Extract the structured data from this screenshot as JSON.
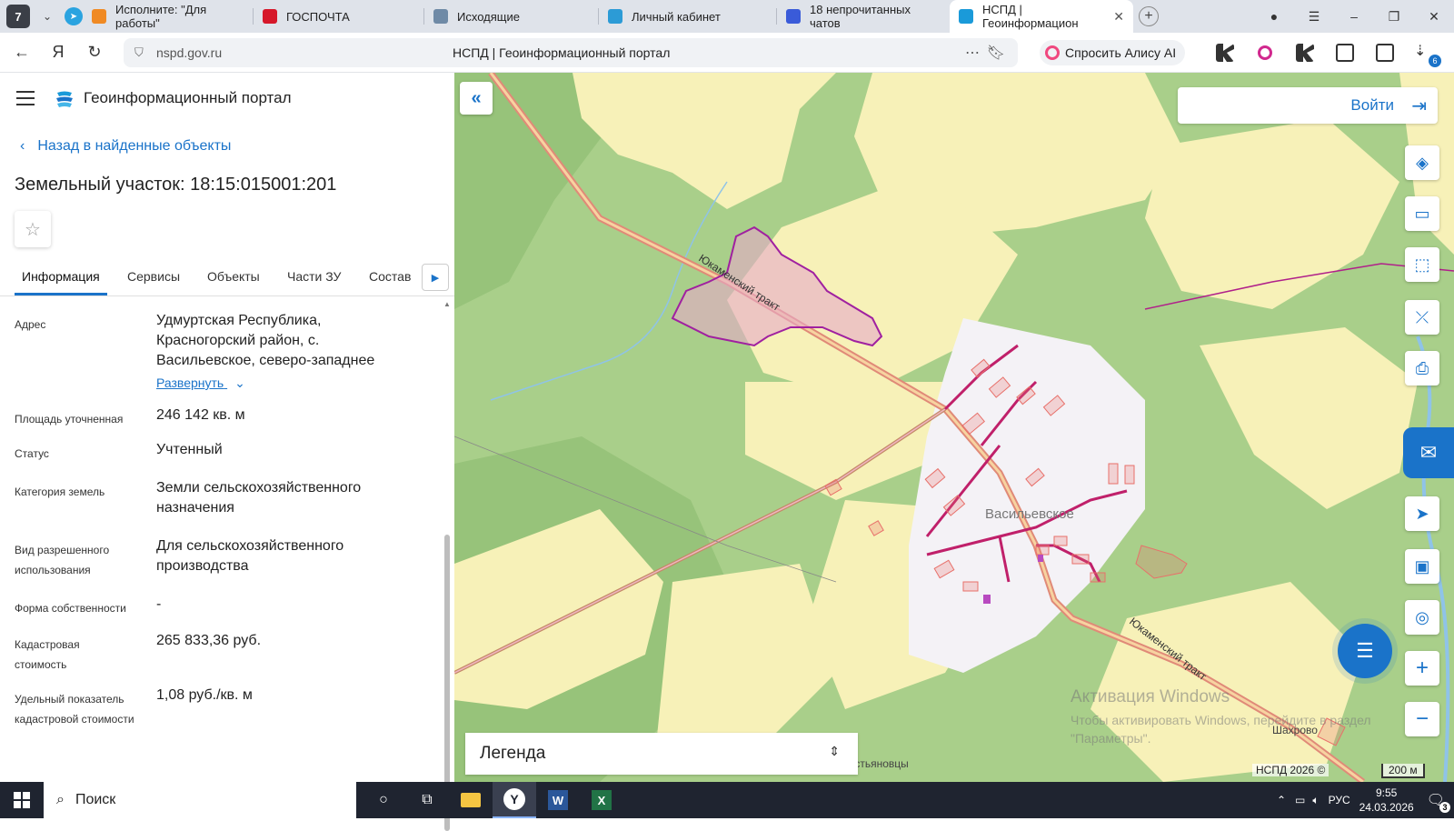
{
  "browser": {
    "tab_count": "7",
    "tabs": [
      {
        "label": "Исполните: \"Для работы\"",
        "color": "#f08a24"
      },
      {
        "label": "ГОСПОЧТА",
        "color": "#d6182a"
      },
      {
        "label": "Исходящие",
        "color": "#6f8aa6"
      },
      {
        "label": "Личный кабинет",
        "color": "#2c9bd6"
      },
      {
        "label": "18 непрочитанных чатов",
        "color": "#3a5bd9"
      },
      {
        "label": "НСПД | Геоинформацион",
        "color": "#1a9ad9"
      }
    ],
    "url_host": "nspd.gov.ru",
    "page_title": "НСПД | Геоинформационный портал",
    "alisa_label": "Спросить Алису AI",
    "download_badge": "6"
  },
  "panel": {
    "brand": "Геоинформационный портал",
    "back_label": "Назад в найденные объекты",
    "title": "Земельный участок: 18:15:015001:201",
    "tabs": [
      "Информация",
      "Сервисы",
      "Объекты",
      "Части ЗУ",
      "Состав"
    ],
    "fields": {
      "address_label": "Адрес",
      "address_value": "Удмуртская Республика, Красногорский район, с. Васильевское, северо-западнее",
      "expand_label": "Развернуть",
      "area_label": "Площадь уточненная",
      "area_value": "246 142 кв. м",
      "status_label": "Статус",
      "status_value": "Учтенный",
      "category_label": "Категория земель",
      "category_value": "Земли сельскохозяйственного назначения",
      "use_label": "Вид разрешенного использования",
      "use_value": "Для сельскохозяйственного производства",
      "ownership_label": "Форма собственности",
      "ownership_value": "-",
      "cost_label": "Кадастровая стоимость",
      "cost_value": "265 833,36 руб.",
      "specific_label": "Удельный показатель кадастровой стоимости",
      "specific_value": "1,08 руб./кв. м"
    }
  },
  "map": {
    "login_label": "Войти",
    "legend_label": "Легенда",
    "village_label": "Васильевское",
    "road_label_1": "Юкаменский тракт",
    "road_label_2": "Юкаменский тракт",
    "village_2": "Шахрово",
    "village_3": "Савастьяновцы",
    "attribution": "НСПД 2026 ©",
    "scale": "200 м",
    "watermark_title": "Активация Windows",
    "watermark_text": "Чтобы активировать Windows, перейдите в раздел \"Параметры\"."
  },
  "taskbar": {
    "search_placeholder": "Поиск",
    "lang": "РУС",
    "time": "9:55",
    "date": "24.03.2026",
    "notif_count": "3"
  },
  "colors": {
    "accent": "#1a73c9",
    "forest": "#a9cf8a",
    "field": "#f7f1b8",
    "parcel_border": "#b0208a",
    "building": "#e8706a"
  }
}
